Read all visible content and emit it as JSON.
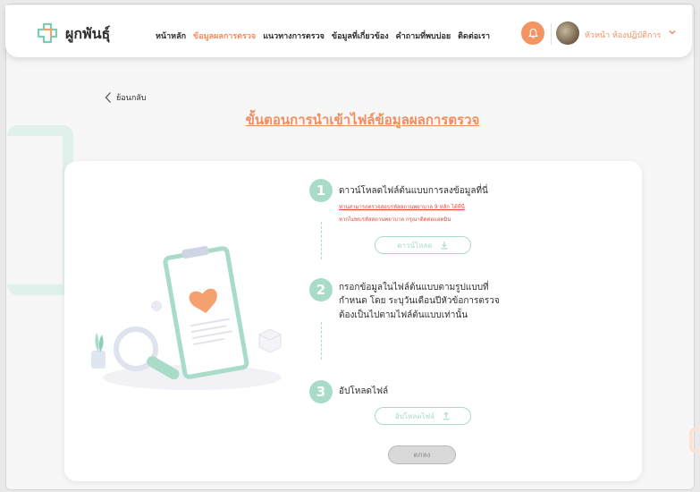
{
  "brand": {
    "name": "ผูกพันธ์ุ"
  },
  "nav": {
    "items": [
      {
        "label": "หน้าหลัก",
        "active": false
      },
      {
        "label": "ข้อมูลผลการตรวจ",
        "active": true
      },
      {
        "label": "แนวทางการตรวจ",
        "active": false
      },
      {
        "label": "ข้อมูลที่เกี่ยวข้อง",
        "active": false
      },
      {
        "label": "คำถามที่พบบ่อย",
        "active": false
      },
      {
        "label": "ติดต่อเรา",
        "active": false
      }
    ]
  },
  "user": {
    "name": "หัวหน้า ห้องปฏิบัติการ"
  },
  "back_label": "ย้อนกลับ",
  "page_title": "ขั้นตอนการนำเข้าไฟล์ข้อมูลผลการตรวจ",
  "steps": [
    {
      "number": "1",
      "title": "ดาวน์โหลดไฟล์ต้นแบบการลงข้อมูลที่นี่",
      "note_line1": "ท่านสามารถตรวจสอบรหัสสถานพยาบาล 9 หลัก ได้ที่นี่",
      "note_line2": "หากไม่พบรหัสสถานพยาบาล กรุณาติดต่อแอดมิน",
      "button_label": "ดาวน์โหลด"
    },
    {
      "number": "2",
      "title_line1": "กรอกข้อมูลในไฟล์ต้นแบบตามรูปแบบที่",
      "title_line2": "กำหนด โดย ระบุวันเดือนปีหัวข้อการตรวจ",
      "title_line3": "ต้องเป็นไปตามไฟล์ต้นแบบเท่านั้น"
    },
    {
      "number": "3",
      "title": "อัปโหลดไฟล์",
      "button_label": "อัปโหลดไฟล์"
    }
  ],
  "ok_label": "ตกลง",
  "colors": {
    "accent": "#f28d5e",
    "mint": "#a8dcc8",
    "danger": "#e3463d"
  }
}
